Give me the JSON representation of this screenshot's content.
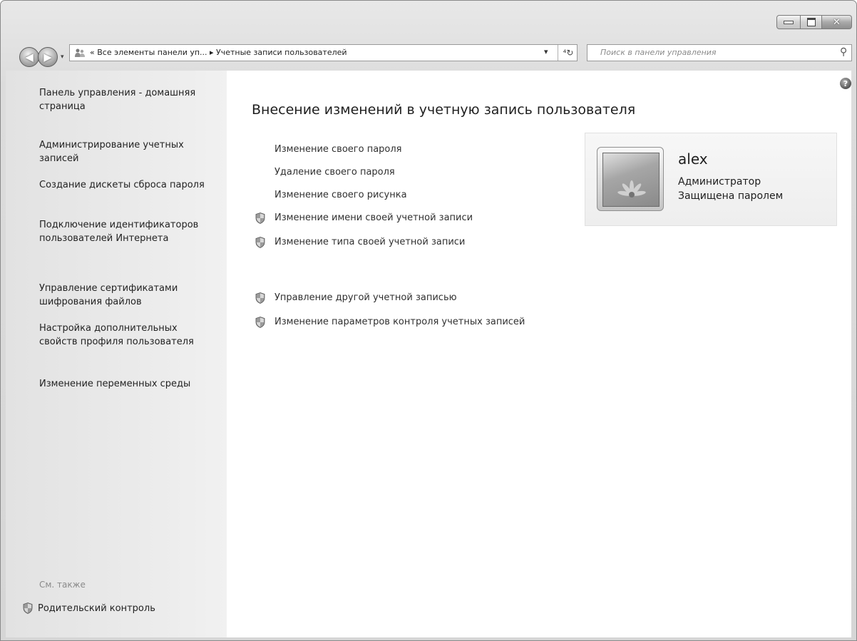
{
  "titlebar": {
    "minimize_glyph": "",
    "maximize_glyph": "",
    "close_glyph": "✕"
  },
  "navigation": {
    "back_glyph": "◀",
    "forward_glyph": "▶",
    "history_dropdown_glyph": "▾",
    "address": "« Все элементы панели уп... ▸ Учетные записи пользователей",
    "address_dropdown_glyph": "▾",
    "refresh_glyph": "⁴↻",
    "search_placeholder": "Поиск в панели управления",
    "search_icon": "search-icon"
  },
  "sidebar": {
    "links": [
      "Панель управления - домашняя страница",
      "Администрирование учетных записей",
      "Создание дискеты сброса пароля",
      "Подключение идентификаторов пользователей Интернета",
      "Управление сертификатами шифрования файлов",
      "Настройка дополнительных свойств профиля пользователя",
      "Изменение переменных среды"
    ],
    "see_also": "См. также",
    "parental_control": "Родительский контроль"
  },
  "main": {
    "help_glyph": "?",
    "title": "Внесение изменений в учетную запись пользователя",
    "tasks": [
      "Изменение своего пароля",
      "Удаление своего пароля",
      "Изменение своего рисунка",
      "Изменение имени своей учетной записи",
      "Изменение типа своей учетной записи"
    ],
    "other_tasks": [
      "Управление другой учетной записью",
      "Изменение параметров контроля учетных записей"
    ]
  },
  "user": {
    "name": "alex",
    "role": "Администратор",
    "status": "Защищена паролем"
  },
  "colors": {
    "sidebar_bg": "#e6e6e6",
    "main_bg": "#ffffff",
    "frame": "#dcdcdc"
  }
}
